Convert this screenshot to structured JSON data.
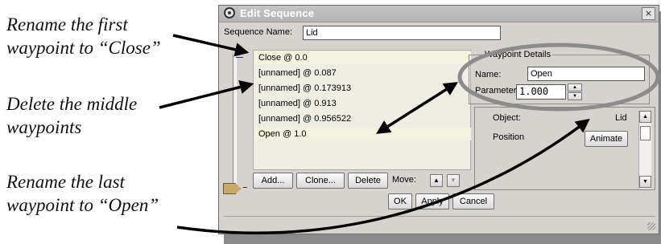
{
  "annotations": {
    "rename_first_line1": "Rename the first",
    "rename_first_line2": "waypoint to “Close”",
    "delete_middle_line1": "Delete the middle",
    "delete_middle_line2": "waypoints",
    "rename_last_line1": "Rename the last",
    "rename_last_line2": "waypoint to “Open”"
  },
  "dialog": {
    "title": "Edit Sequence",
    "close_icon": "×",
    "sequence_name_label": "Sequence Name:",
    "sequence_name_value": "Lid",
    "waypoints": [
      "Close @ 0.0",
      "[unnamed] @ 0.087",
      "[unnamed] @ 0.173913",
      "[unnamed] @ 0.913",
      "[unnamed] @ 0.956522",
      "Open @ 1.0"
    ],
    "buttons": {
      "add": "Add...",
      "clone": "Clone...",
      "delete": "Delete",
      "move_label": "Move:",
      "move_up": "▲",
      "move_down": "▼",
      "ok": "OK",
      "apply": "Apply",
      "cancel": "Cancel"
    },
    "waypoint_details": {
      "group_title": "Waypoint Details",
      "name_label": "Name:",
      "name_value": "Open",
      "parameter_label": "Parameter:",
      "parameter_value": "1.000"
    },
    "properties": {
      "object_label": "Object:",
      "object_value": "Lid",
      "position_label": "Position",
      "animate_button": "Animate"
    }
  },
  "colors": {
    "dialog_bg": "#d6d3ce",
    "title_bar": "#b8b8b8",
    "list_bg": "#eeeee4",
    "highlight_ellipse": "#8c8c8c",
    "annotation_arrow": "#000000"
  }
}
